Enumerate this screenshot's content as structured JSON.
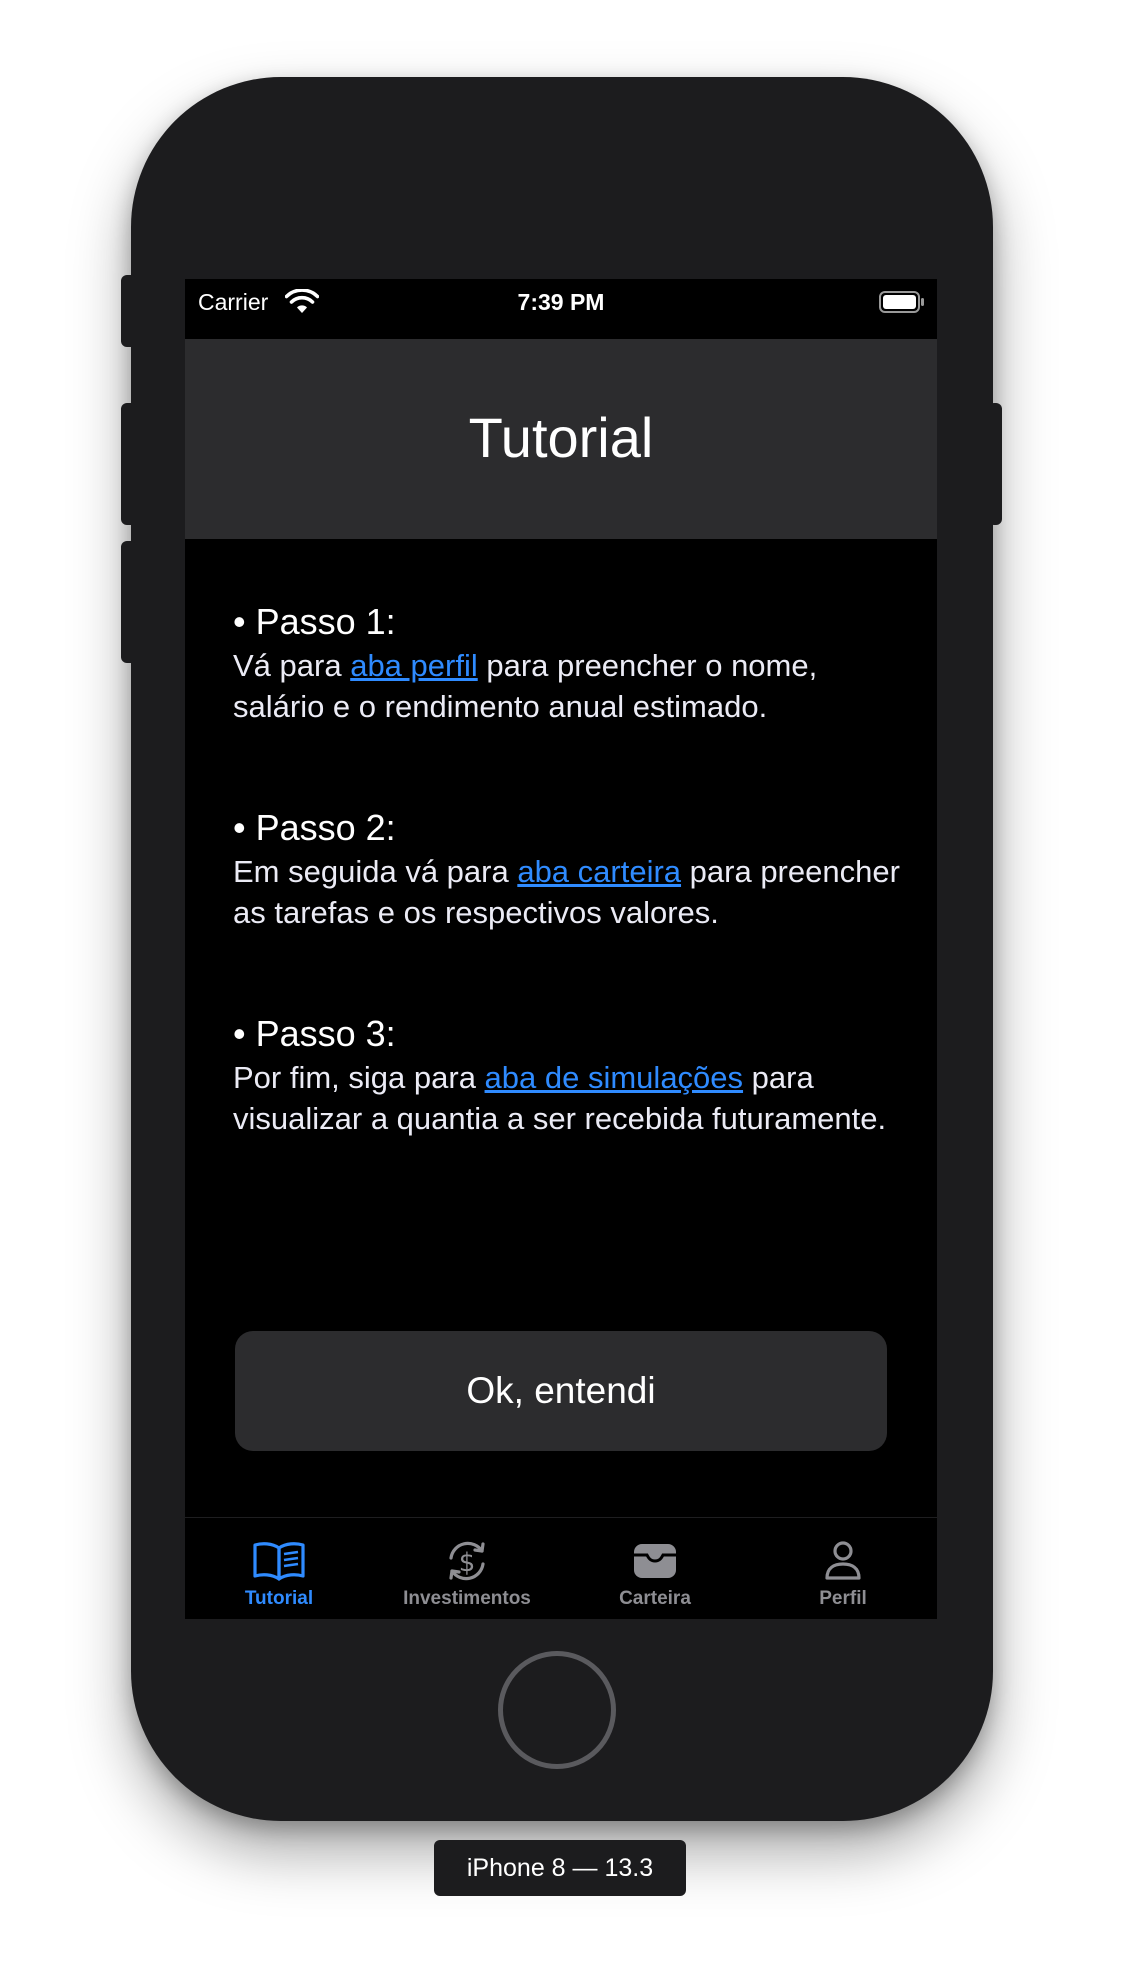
{
  "status_bar": {
    "carrier": "Carrier",
    "time": "7:39 PM",
    "wifi_icon": "wifi-icon",
    "battery_icon": "battery-icon"
  },
  "nav": {
    "title": "Tutorial"
  },
  "steps": [
    {
      "heading": "• Passo 1:",
      "before": "Vá para ",
      "link": "aba perfil",
      "after": " para preencher o nome, salário e o rendimento anual estimado."
    },
    {
      "heading": "• Passo 2:",
      "before": "Em seguida vá para ",
      "link": "aba carteira",
      "after": " para preencher as tarefas e os respectivos valores."
    },
    {
      "heading": "• Passo 3:",
      "before": "Por fim, siga para ",
      "link": "aba de simulações",
      "after": " para visualizar a quantia a ser recebida futuramente."
    }
  ],
  "ok_button": {
    "label": "Ok, entendi"
  },
  "tabs": [
    {
      "label": "Tutorial",
      "icon": "book-icon",
      "active": true
    },
    {
      "label": "Investimentos",
      "icon": "dollar-cycle-icon",
      "active": false
    },
    {
      "label": "Carteira",
      "icon": "wallet-icon",
      "active": false
    },
    {
      "label": "Perfil",
      "icon": "person-icon",
      "active": false
    }
  ],
  "device_label": "iPhone 8 — 13.3",
  "colors": {
    "accent": "#2f8bff",
    "background": "#000000",
    "surface": "#2c2c2e",
    "inactive": "#8e8e93"
  }
}
